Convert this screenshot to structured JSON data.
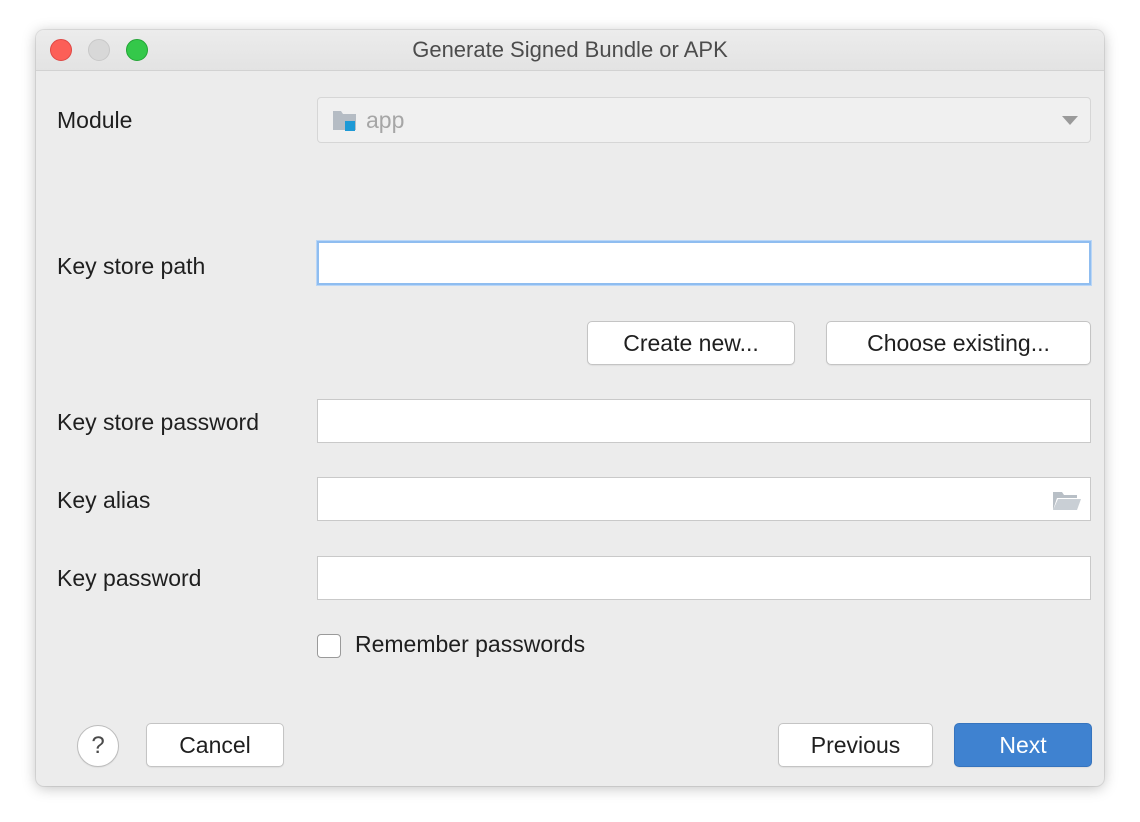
{
  "window": {
    "title": "Generate Signed Bundle or APK"
  },
  "module": {
    "label": "Module",
    "selected_value": "app",
    "icon": "module-folder-icon"
  },
  "keystore": {
    "path_label": "Key store path",
    "path_value": "",
    "create_new_label": "Create new...",
    "choose_existing_label": "Choose existing...",
    "password_label": "Key store password",
    "password_value": ""
  },
  "key": {
    "alias_label": "Key alias",
    "alias_value": "",
    "alias_browse_icon": "folder-open-icon",
    "password_label": "Key password",
    "password_value": ""
  },
  "remember": {
    "label": "Remember passwords",
    "checked": false
  },
  "footer": {
    "help_label": "?",
    "cancel_label": "Cancel",
    "previous_label": "Previous",
    "next_label": "Next"
  },
  "colors": {
    "accent": "#3f82d0",
    "focus_ring": "#8fbdf0",
    "close": "#fc5f57",
    "zoom": "#34c84a",
    "module_icon_accent": "#1e9ad6"
  }
}
